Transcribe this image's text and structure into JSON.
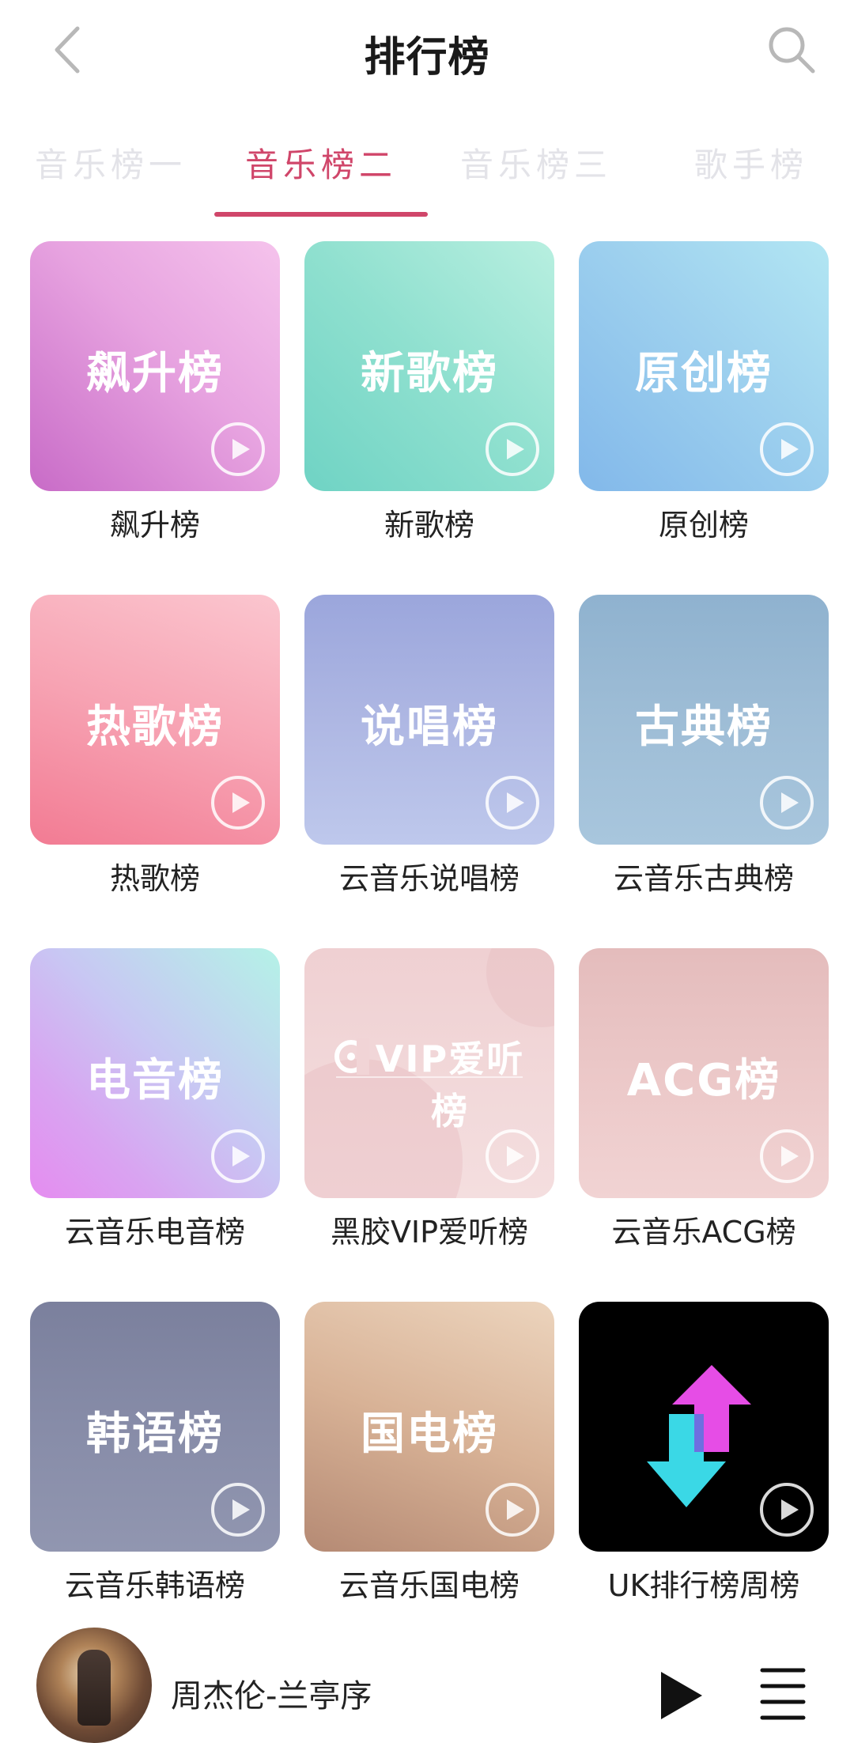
{
  "header": {
    "title": "排行榜"
  },
  "tabs": [
    {
      "label": "音乐榜一",
      "active": false
    },
    {
      "label": "音乐榜二",
      "active": true
    },
    {
      "label": "音乐榜三",
      "active": false
    },
    {
      "label": "歌手榜",
      "active": false
    }
  ],
  "charts": [
    {
      "tile_title": "飙升榜",
      "label": "飙升榜"
    },
    {
      "tile_title": "新歌榜",
      "label": "新歌榜"
    },
    {
      "tile_title": "原创榜",
      "label": "原创榜"
    },
    {
      "tile_title": "热歌榜",
      "label": "热歌榜"
    },
    {
      "tile_title": "说唱榜",
      "label": "云音乐说唱榜"
    },
    {
      "tile_title": "古典榜",
      "label": "云音乐古典榜"
    },
    {
      "tile_title": "电音榜",
      "label": "云音乐电音榜"
    },
    {
      "tile_title": "VIP爱听榜",
      "label": "黑胶VIP爱听榜"
    },
    {
      "tile_title": "ACG榜",
      "label": "云音乐ACG榜"
    },
    {
      "tile_title": "韩语榜",
      "label": "云音乐韩语榜"
    },
    {
      "tile_title": "国电榜",
      "label": "云音乐国电榜"
    },
    {
      "tile_title": "",
      "label": "UK排行榜周榜"
    }
  ],
  "player": {
    "song": "周杰伦-兰亭序"
  },
  "colors": {
    "accent": "#d0466a",
    "inactive_tab": "#e3e3e8"
  },
  "icons": [
    "back-icon",
    "search-icon",
    "play-circle-icon",
    "play-icon",
    "playlist-icon",
    "vinyl-icon",
    "uk-arrows-icon"
  ]
}
